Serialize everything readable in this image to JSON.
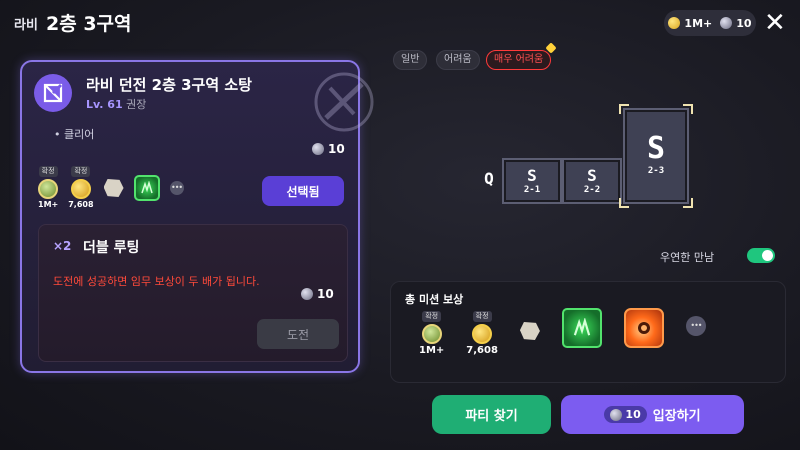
{
  "header": {
    "region": "라비",
    "floor": "2층 3구역",
    "currency": {
      "gold": "1M+",
      "stones": "10"
    }
  },
  "left_panel": {
    "title": "라비 던전 2층 3구역 소탕",
    "level_value": "Lv. 61",
    "level_suffix": "권장",
    "clear_label": "• 클리어",
    "cost": "10",
    "rewards": [
      {
        "type": "exp",
        "badge": "확정",
        "caption": "1M+"
      },
      {
        "type": "gold",
        "badge": "확정",
        "caption": "7,608"
      },
      {
        "type": "ore"
      },
      {
        "type": "green-box"
      },
      {
        "type": "more"
      }
    ],
    "selected_label": "선택됨"
  },
  "double_looting": {
    "multiplier": "×2",
    "title": "더블 루팅",
    "description": "도전에 성공하면 임무 보상이 두 배가 됩니다.",
    "cost": "10",
    "challenge_label": "도전"
  },
  "difficulty_tabs": [
    "일반",
    "어려움",
    "매우 어려움"
  ],
  "active_difficulty": 2,
  "map": {
    "rooms": [
      {
        "letter": "S",
        "id": "2-1"
      },
      {
        "letter": "S",
        "id": "2-2"
      },
      {
        "letter": "S",
        "id": "2-3"
      }
    ],
    "exit_letter": "Q",
    "current_room": "2-3"
  },
  "toggle": {
    "label": "우연한 만남",
    "on": true
  },
  "mission_rewards": {
    "title": "총 미션 보상",
    "items": [
      {
        "type": "exp",
        "badge": "확정",
        "caption": "1M+"
      },
      {
        "type": "gold",
        "badge": "확정",
        "caption": "7,608"
      },
      {
        "type": "ore"
      },
      {
        "type": "green-box"
      },
      {
        "type": "orange-box"
      },
      {
        "type": "more"
      }
    ]
  },
  "buttons": {
    "party": "파티 찾기",
    "enter": "입장하기",
    "enter_cost": "10"
  },
  "colors": {
    "accent_purple": "#7c5cf0",
    "accent_green": "#1fae74",
    "warning_red": "#ff4a3a",
    "panel_border": "#8a76e6"
  }
}
